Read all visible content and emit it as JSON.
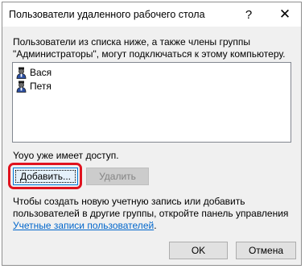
{
  "window": {
    "title": "Пользователи удаленного рабочего стола",
    "help_label": "?",
    "close_label": "✕"
  },
  "description": "Пользователи из списка ниже, а также члены группы \"Администраторы\", могут подключаться к этому компьютеру.",
  "users": [
    {
      "name": "Вася",
      "icon": "user-icon"
    },
    {
      "name": "Петя",
      "icon": "user-icon"
    }
  ],
  "access_status": "Yoyo уже имеет доступ.",
  "buttons": {
    "add": "Добавить...",
    "remove": "Удалить",
    "ok": "OK",
    "cancel": "Отмена"
  },
  "info": {
    "text": "Чтобы создать новую учетную запись или добавить пользователей в другие группы, откройте панель управления ",
    "link": "Учетные записи пользователей",
    "suffix": "."
  },
  "colors": {
    "highlight": "#e0121e",
    "link": "#0066cc",
    "focus": "#0078d7"
  }
}
